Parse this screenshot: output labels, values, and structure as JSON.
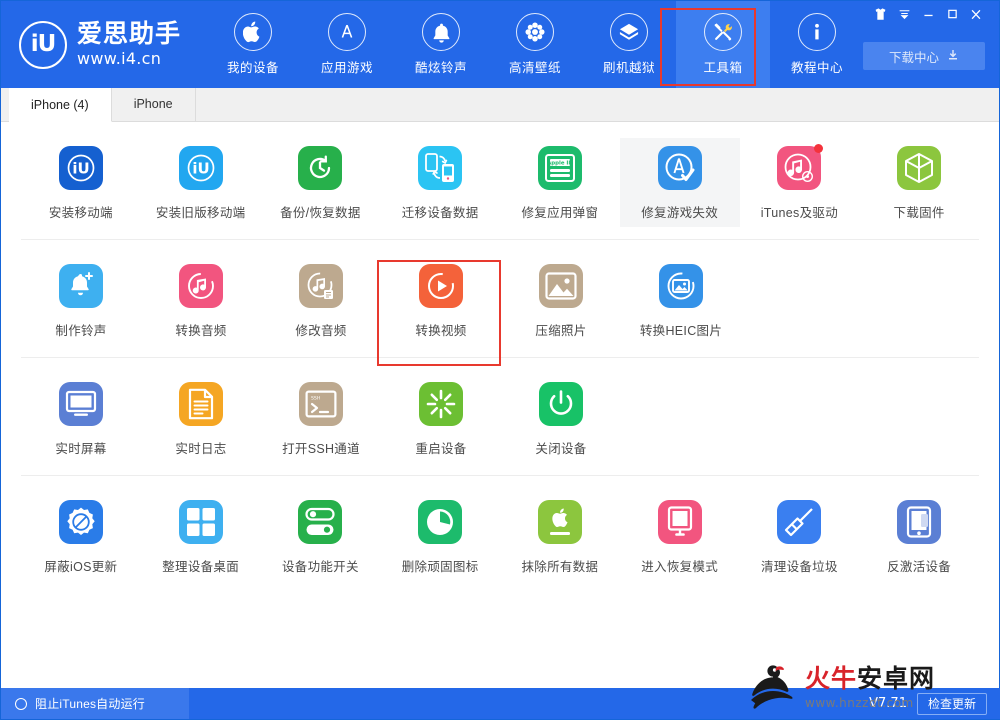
{
  "brand": {
    "logo_mark": "iU",
    "name_cn": "爱思助手",
    "url": "www.i4.cn"
  },
  "header": {
    "nav": [
      {
        "label": "我的设备",
        "icon": "apple-icon",
        "active": false
      },
      {
        "label": "应用游戏",
        "icon": "appstore-icon",
        "active": false
      },
      {
        "label": "酷炫铃声",
        "icon": "bell-icon",
        "active": false
      },
      {
        "label": "高清壁纸",
        "icon": "flower-icon",
        "active": false
      },
      {
        "label": "刷机越狱",
        "icon": "box-open-icon",
        "active": false
      },
      {
        "label": "工具箱",
        "icon": "tools-icon",
        "active": true
      },
      {
        "label": "教程中心",
        "icon": "info-icon",
        "active": false
      }
    ],
    "download_center": "下载中心",
    "window_controls": [
      {
        "name": "skin-icon",
        "glyph": "\u0000"
      },
      {
        "name": "menu-icon",
        "glyph": "\u0000"
      },
      {
        "name": "minimize-icon",
        "glyph": "\u0000"
      },
      {
        "name": "maximize-icon",
        "glyph": "\u0000"
      },
      {
        "name": "close-icon",
        "glyph": "\u0000"
      }
    ]
  },
  "tabs": [
    {
      "label": "iPhone (4)",
      "active": true
    },
    {
      "label": "iPhone",
      "active": false
    }
  ],
  "toolbox": {
    "rows": [
      [
        {
          "label": "安装移动端",
          "icon": "i4-app-icon",
          "color": "#1560d0",
          "badge": false,
          "hover": false,
          "highlight": false
        },
        {
          "label": "安装旧版移动端",
          "icon": "i4-app-old-icon",
          "color": "#22a7f0",
          "badge": false,
          "hover": false,
          "highlight": false
        },
        {
          "label": "备份/恢复数据",
          "icon": "restore-icon",
          "color": "#27b04b",
          "badge": false,
          "hover": false,
          "highlight": false
        },
        {
          "label": "迁移设备数据",
          "icon": "migrate-icon",
          "color": "#2bc4f3",
          "badge": false,
          "hover": false,
          "highlight": true
        },
        {
          "label": "修复应用弹窗",
          "icon": "appleid-card-icon",
          "color": "#1dbb6c",
          "badge": false,
          "hover": false,
          "highlight": false
        },
        {
          "label": "修复游戏失效",
          "icon": "appstore-fix-icon",
          "color": "#3492e8",
          "badge": false,
          "hover": true,
          "highlight": false
        },
        {
          "label": "iTunes及驱动",
          "icon": "itunes-icon",
          "color": "#f2557f",
          "badge": true,
          "hover": false,
          "highlight": false
        },
        {
          "label": "下载固件",
          "icon": "firmware-box-icon",
          "color": "#8cc63e",
          "badge": false,
          "hover": false,
          "highlight": false
        }
      ],
      [
        {
          "label": "制作铃声",
          "icon": "ringtone-make-icon",
          "color": "#3eb0f0",
          "badge": false,
          "hover": false,
          "highlight": false
        },
        {
          "label": "转换音频",
          "icon": "audio-convert-icon",
          "color": "#f2557f",
          "badge": false,
          "hover": false,
          "highlight": false
        },
        {
          "label": "修改音频",
          "icon": "audio-edit-icon",
          "color": "#bda98f",
          "badge": false,
          "hover": false,
          "highlight": false
        },
        {
          "label": "转换视频",
          "icon": "video-convert-icon",
          "color": "#f4623a",
          "badge": false,
          "hover": false,
          "highlight": false
        },
        {
          "label": "压缩照片",
          "icon": "photo-compress-icon",
          "color": "#bda98f",
          "badge": false,
          "hover": false,
          "highlight": false
        },
        {
          "label": "转换HEIC图片",
          "icon": "heic-convert-icon",
          "color": "#3492e8",
          "badge": false,
          "hover": false,
          "highlight": false
        }
      ],
      [
        {
          "label": "实时屏幕",
          "icon": "screen-mirror-icon",
          "color": "#5b7fd4",
          "badge": false,
          "hover": false,
          "highlight": false
        },
        {
          "label": "实时日志",
          "icon": "log-file-icon",
          "color": "#f5a623",
          "badge": false,
          "hover": false,
          "highlight": false
        },
        {
          "label": "打开SSH通道",
          "icon": "ssh-terminal-icon",
          "color": "#bda98f",
          "badge": false,
          "hover": false,
          "highlight": false
        },
        {
          "label": "重启设备",
          "icon": "restart-icon",
          "color": "#6cbf33",
          "badge": false,
          "hover": false,
          "highlight": false
        },
        {
          "label": "关闭设备",
          "icon": "power-off-icon",
          "color": "#18c267",
          "badge": false,
          "hover": false,
          "highlight": false
        }
      ],
      [
        {
          "label": "屏蔽iOS更新",
          "icon": "block-update-icon",
          "color": "#2a7ce8",
          "badge": false,
          "hover": false,
          "highlight": false
        },
        {
          "label": "整理设备桌面",
          "icon": "desktop-tidy-icon",
          "color": "#3eb0f0",
          "badge": false,
          "hover": false,
          "highlight": false
        },
        {
          "label": "设备功能开关",
          "icon": "toggle-switch-icon",
          "color": "#27b04b",
          "badge": false,
          "hover": false,
          "highlight": false
        },
        {
          "label": "删除顽固图标",
          "icon": "remove-icon-icon",
          "color": "#1dbb6c",
          "badge": false,
          "hover": false,
          "highlight": false
        },
        {
          "label": "抹除所有数据",
          "icon": "erase-apple-icon",
          "color": "#8cc63e",
          "badge": false,
          "hover": false,
          "highlight": false
        },
        {
          "label": "进入恢复模式",
          "icon": "recovery-mode-icon",
          "color": "#f2557f",
          "badge": false,
          "hover": false,
          "highlight": false
        },
        {
          "label": "清理设备垃圾",
          "icon": "clean-broom-icon",
          "color": "#3a7ff0",
          "badge": false,
          "hover": false,
          "highlight": false
        },
        {
          "label": "反激活设备",
          "icon": "deactivate-icon",
          "color": "#5b7fd4",
          "badge": false,
          "hover": false,
          "highlight": false
        }
      ]
    ]
  },
  "statusbar": {
    "block_itunes_label": "阻止iTunes自动运行",
    "version": "V7.71",
    "check_update_label": "检查更新"
  },
  "watermark": {
    "main_red": "火牛",
    "main_black": "安卓网",
    "sub": "www.hnzzdt.com"
  },
  "colors": {
    "header_blue": "#2468e8",
    "nav_active_blue": "#3d7ef0",
    "highlight_red": "#e8392e",
    "statusbar_blue": "#2468e8"
  }
}
